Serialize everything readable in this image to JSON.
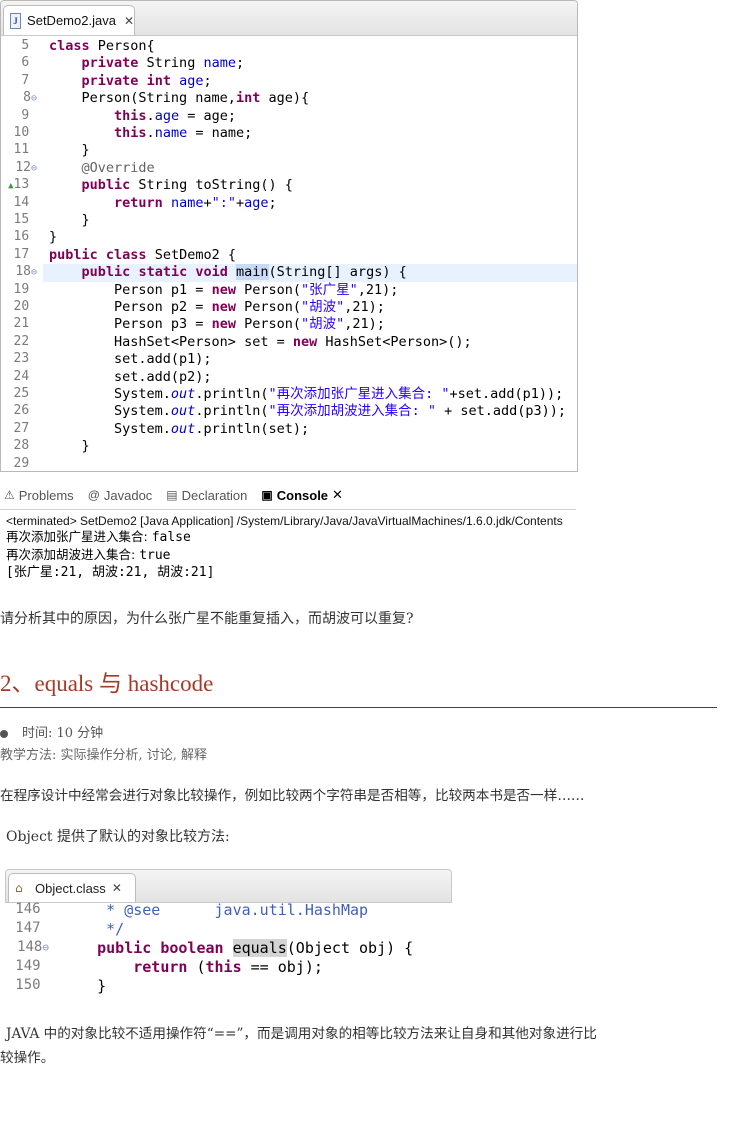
{
  "editor": {
    "tab_title": "SetDemo2.java",
    "lines": [
      {
        "n": "5",
        "html": "<span class='kw'>class</span> Person{"
      },
      {
        "n": "6",
        "html": "    <span class='kw'>private</span> String <span class='fld'>name</span>;"
      },
      {
        "n": "7",
        "html": "    <span class='kw'>private</span> <span class='kw'>int</span> <span class='fld'>age</span>;"
      },
      {
        "n": "8",
        "fold": true,
        "html": "    Person(String name,<span class='kw'>int</span> age){"
      },
      {
        "n": "9",
        "html": "        <span class='kw'>this</span>.<span class='fld'>age</span> = age;"
      },
      {
        "n": "10",
        "html": "        <span class='kw'>this</span>.<span class='fld'>name</span> = name;"
      },
      {
        "n": "11",
        "html": "    }"
      },
      {
        "n": "12",
        "fold": true,
        "html": "    <span class='ann'>@Override</span>"
      },
      {
        "n": "13",
        "arrow": true,
        "html": "    <span class='kw'>public</span> String toString() {"
      },
      {
        "n": "14",
        "html": "        <span class='kw'>return</span> <span class='fld'>name</span>+<span class='str'>\":\"</span>+<span class='fld'>age</span>;"
      },
      {
        "n": "15",
        "html": "    }"
      },
      {
        "n": "16",
        "html": "}"
      },
      {
        "n": "17",
        "html": "<span class='kw'>public</span> <span class='kw'>class</span> SetDemo2 {"
      },
      {
        "n": "18",
        "fold": true,
        "current": true,
        "html": "    <span class='kw'>public</span> <span class='kw'>static</span> <span class='kw'>void</span> <span class='sel'>main</span>(String[] args) {"
      },
      {
        "n": "19",
        "html": "        Person p1 = <span class='kw'>new</span> Person(<span class='str'>\"张广星\"</span>,21);"
      },
      {
        "n": "20",
        "html": "        Person p2 = <span class='kw'>new</span> Person(<span class='str'>\"胡波\"</span>,21);"
      },
      {
        "n": "21",
        "html": "        Person p3 = <span class='kw'>new</span> Person(<span class='str'>\"胡波\"</span>,21);"
      },
      {
        "n": "22",
        "html": "        HashSet&lt;Person&gt; set = <span class='kw'>new</span> HashSet&lt;Person&gt;();"
      },
      {
        "n": "23",
        "html": "        set.add(p1);"
      },
      {
        "n": "24",
        "html": "        set.add(p2);"
      },
      {
        "n": "25",
        "html": "        System.<span class='st'>out</span>.println(<span class='str'>\"再次添加张广星进入集合: \"</span>+set.add(p1));"
      },
      {
        "n": "26",
        "html": "        System.<span class='st'>out</span>.println(<span class='str'>\"再次添加胡波进入集合: \"</span> + set.add(p3));"
      },
      {
        "n": "27",
        "html": "        System.<span class='st'>out</span>.println(set);"
      },
      {
        "n": "28",
        "html": "    }"
      },
      {
        "n": "29",
        "html": ""
      }
    ]
  },
  "console": {
    "tabs": [
      {
        "icon": "problems-icon",
        "glyph": "⚠",
        "label": "Problems"
      },
      {
        "icon": "javadoc-icon",
        "glyph": "@",
        "label": "Javadoc"
      },
      {
        "icon": "declaration-icon",
        "glyph": "▤",
        "label": "Declaration"
      },
      {
        "icon": "console-icon",
        "glyph": "▣",
        "label": "Console",
        "active": true
      }
    ],
    "terminated": "<terminated> SetDemo2 [Java Application] /System/Library/Java/JavaVirtualMachines/1.6.0.jdk/Contents",
    "output1_label": "再次添加张广星进入集合: ",
    "output1_value": "false",
    "output2_label": "再次添加胡波进入集合: ",
    "output2_value": "true",
    "output3": "[张广星:21, 胡波:21, 胡波:21]"
  },
  "doc": {
    "question": "请分析其中的原因，为什么张广星不能重复插入，而胡波可以重复?",
    "heading": "2、equals 与 hashcode",
    "meta_time": "时间:   10 分钟",
    "meta_method": "教学方法: 实际操作分析, 讨论, 解释",
    "para1": "在程序设计中经常会进行对象比较操作，例如比较两个字符串是否相等，比较两本书是否一样……",
    "para2": "Object 提供了默认的对象比较方法:",
    "para3_line1": "JAVA 中的对象比较不适用操作符“==”，而是调用对象的相等比较方法来让自身和其他对象进行比",
    "para3_line2": "较操作。"
  },
  "editor2": {
    "tab_title": "Object.class",
    "lines": [
      {
        "n": "146",
        "html": "     <span class='jdoc'>* @see      java.util.HashMap</span>"
      },
      {
        "n": "147",
        "html": "     <span class='jdoc'>*/</span>"
      },
      {
        "n": "148",
        "fold": true,
        "html": "    <span class='kw'>public</span> <span class='kw'>boolean</span> <span class='hl'>equals</span>(Object obj) {"
      },
      {
        "n": "149",
        "html": "        <span class='kw'>return</span> (<span class='kw'>this</span> == obj);"
      },
      {
        "n": "150",
        "html": "    }"
      }
    ]
  }
}
